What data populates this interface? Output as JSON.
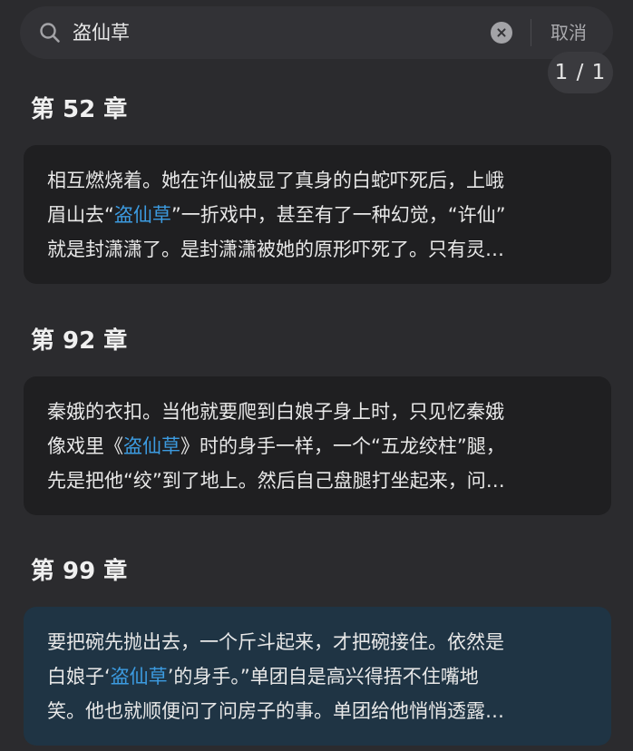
{
  "search": {
    "value": "盗仙草",
    "cancel_label": "取消"
  },
  "page_indicator": "1 / 1",
  "results": [
    {
      "chapter": "第 52 章",
      "lines": [
        {
          "pre": "相互燃烧着。她在许仙被显了真身的白蛇吓死后，上峨",
          "hl": "",
          "post": ""
        },
        {
          "pre": "眉山去“",
          "hl": "盗仙草",
          "post": "”一折戏中，甚至有了一种幻觉，“许仙”"
        },
        {
          "pre": "就是封潇潇了。是封潇潇被她的原形吓死了。只有灵…",
          "hl": "",
          "post": ""
        }
      ]
    },
    {
      "chapter": "第 92 章",
      "lines": [
        {
          "pre": "秦娥的衣扣。当他就要爬到白娘子身上时，只见忆秦娥",
          "hl": "",
          "post": ""
        },
        {
          "pre": "像戏里《",
          "hl": "盗仙草",
          "post": "》时的身手一样，一个“五龙绞柱”腿，"
        },
        {
          "pre": "先是把他“绞”到了地上。然后自己盘腿打坐起来，问…",
          "hl": "",
          "post": ""
        }
      ]
    },
    {
      "chapter": "第 99 章",
      "lines": [
        {
          "pre": "要把碗先抛出去，一个斤斗起来，才把碗接住。依然是",
          "hl": "",
          "post": ""
        },
        {
          "pre": "白娘子‘",
          "hl": "盗仙草",
          "post": "’的身手。”单团自是高兴得捂不住嘴地"
        },
        {
          "pre": "笑。他也就顺便问了问房子的事。单团给他悄悄透露…",
          "hl": "",
          "post": ""
        }
      ]
    }
  ],
  "colors": {
    "background": "#2b2b2e",
    "card": "#1f1f21",
    "card_active": "#1f3444",
    "highlight": "#3c9be0"
  }
}
